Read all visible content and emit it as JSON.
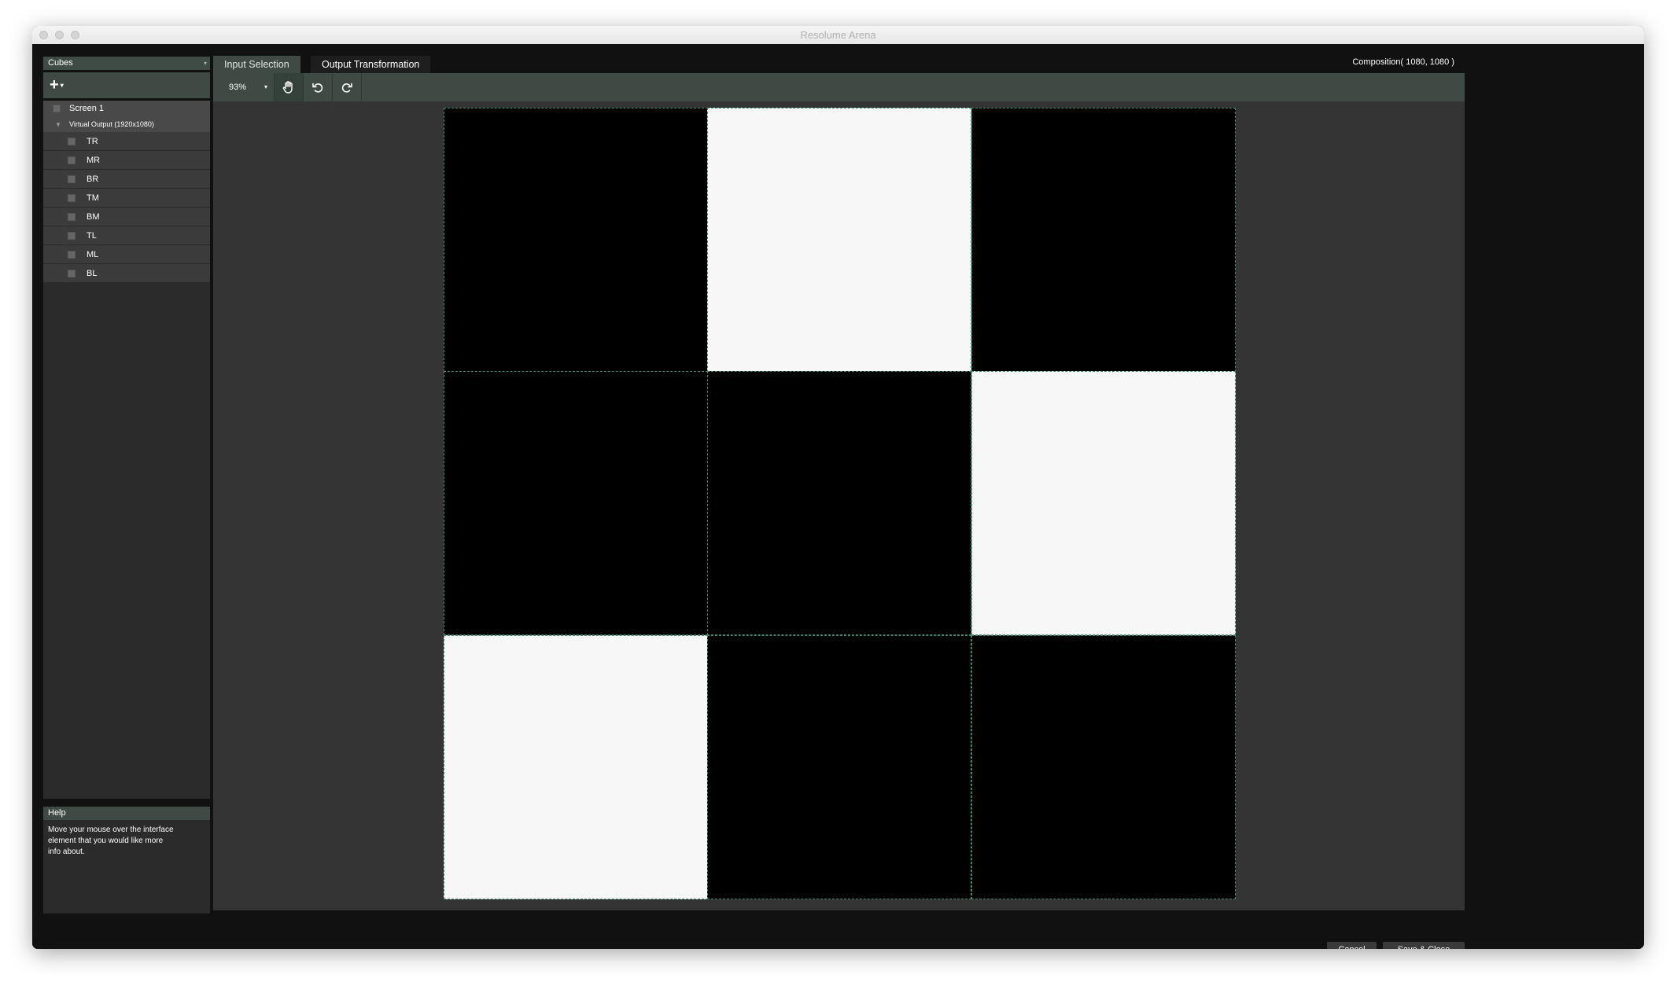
{
  "window": {
    "title": "Resolume Arena"
  },
  "preset": {
    "value": "Cubes"
  },
  "tree": {
    "screen_label": "Screen 1",
    "virtual_output_label": "Virtual Output (1920x1080)",
    "items": [
      "TR",
      "MR",
      "BR",
      "TM",
      "BM",
      "TL",
      "ML",
      "BL"
    ]
  },
  "help": {
    "title": "Help",
    "text": "Move your mouse over the interface element that you would like more info about."
  },
  "tabs": [
    {
      "label": "Input Selection",
      "active": true
    },
    {
      "label": "Output Transformation",
      "active": false
    }
  ],
  "composition_label": "Composition( 1080, 1080 )",
  "toolbar": {
    "zoom": "93%"
  },
  "canvas": {
    "grid": [
      [
        "black",
        "white",
        "black"
      ],
      [
        "black",
        "black",
        "white"
      ],
      [
        "white",
        "black",
        "black"
      ]
    ]
  },
  "footer": {
    "cancel_label": "Cancel",
    "save_label": "Save & Close"
  },
  "colors": {
    "panel_accent": "#3e4a43",
    "canvas_bg": "#343434",
    "selection_outline": "#3f8a72"
  }
}
